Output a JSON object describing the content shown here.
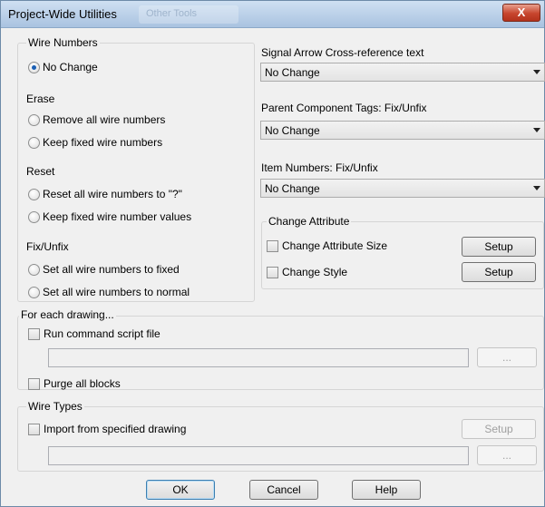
{
  "window": {
    "title": "Project-Wide Utilities",
    "background_tab": "Other Tools",
    "close_glyph": "X"
  },
  "wire_numbers": {
    "group_label": "Wire Numbers",
    "no_change": "No Change",
    "erase_label": "Erase",
    "remove_all": "Remove all wire numbers",
    "keep_fixed": "Keep fixed wire numbers",
    "reset_label": "Reset",
    "reset_all": "Reset all wire numbers to \"?\"",
    "keep_fixed_values": "Keep fixed wire number values",
    "fix_label": "Fix/Unfix",
    "set_fixed": "Set all wire numbers to fixed",
    "set_normal": "Set all wire numbers to normal",
    "selected": "no_change"
  },
  "signal_arrow": {
    "label": "Signal Arrow Cross-reference text",
    "value": "No Change"
  },
  "parent_tags": {
    "label": "Parent Component Tags: Fix/Unfix",
    "value": "No Change"
  },
  "item_numbers": {
    "label": "Item Numbers: Fix/Unfix",
    "value": "No Change"
  },
  "change_attribute": {
    "group_label": "Change Attribute",
    "size_label": "Change Attribute Size",
    "style_label": "Change Style",
    "setup_label": "Setup"
  },
  "each_drawing": {
    "group_label": "For each drawing...",
    "run_script_label": "Run command script file",
    "script_path": "",
    "browse_label": "...",
    "purge_label": "Purge all blocks"
  },
  "wire_types": {
    "group_label": "Wire Types",
    "import_label": "Import from specified drawing",
    "setup_label": "Setup",
    "drawing_path": "",
    "browse_label": "..."
  },
  "buttons": {
    "ok": "OK",
    "cancel": "Cancel",
    "help": "Help"
  },
  "colors": {
    "title_bar": "#bcd2ea",
    "close_button": "#c7452d",
    "dialog_bg": "#f0f0f0",
    "radio_dot": "#1a5fb4"
  }
}
